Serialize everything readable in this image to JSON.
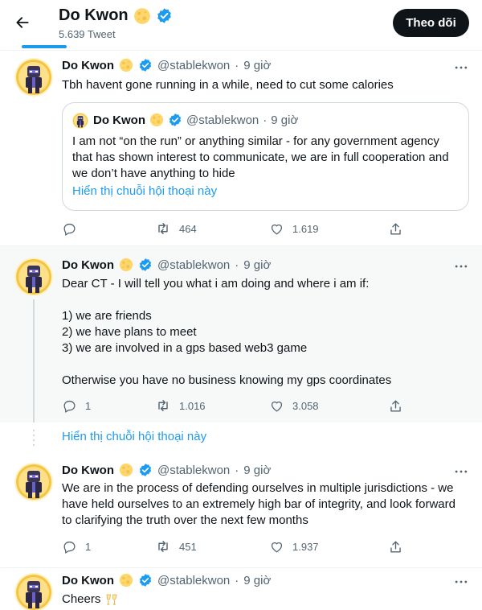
{
  "header": {
    "title": "Do Kwon",
    "tweet_count": "5.639 Tweet",
    "follow_label": "Theo dõi"
  },
  "tweets": [
    {
      "name": "Do Kwon",
      "handle": "@stablekwon",
      "dot": "·",
      "time": "9 giờ",
      "text": "Tbh havent gone running in a while, need to cut some calories",
      "quote": {
        "name": "Do Kwon",
        "handle": "@stablekwon",
        "dot": "·",
        "time": "9 giờ",
        "text": "I am not “on the run” or anything similar - for any government agency that has shown interest to communicate, we are in full cooperation and we don’t have anything to hide",
        "link": "Hiển thị chuỗi hội thoại này"
      },
      "replies": "",
      "retweets": "464",
      "likes": "1.619"
    },
    {
      "name": "Do Kwon",
      "handle": "@stablekwon",
      "dot": "·",
      "time": "9 giờ",
      "text": "Dear CT - I will tell you what i am doing and where i am if:\n\n1) we are friends\n2) we have plans to meet\n3) we are involved in a gps based web3 game\n\nOtherwise you have no business knowing my gps coordinates",
      "replies": "1",
      "retweets": "1.016",
      "likes": "3.058"
    },
    {
      "name": "Do Kwon",
      "handle": "@stablekwon",
      "dot": "·",
      "time": "9 giờ",
      "text": "We are in the process of defending ourselves in multiple jurisdictions - we have held ourselves to an extremely high bar of integrity, and look forward to clarifying the truth over the next few months",
      "replies": "1",
      "retweets": "451",
      "likes": "1.937"
    },
    {
      "name": "Do Kwon",
      "handle": "@stablekwon",
      "dot": "·",
      "time": "9 giờ",
      "text": "Cheers"
    }
  ],
  "show_thread_label": "Hiển thị chuỗi hội thoại này",
  "colors": {
    "accent": "#1d9bf0",
    "text_primary": "#0f1419",
    "text_secondary": "#536471",
    "highlight_bg": "#f7f9f9",
    "follow_bg": "#0f1419",
    "moon": "#ffd66b"
  },
  "icons": [
    "back-arrow-icon",
    "full-moon-icon",
    "verified-badge-icon",
    "more-icon",
    "reply-icon",
    "retweet-icon",
    "like-icon",
    "share-icon",
    "clinking-glasses-icon"
  ]
}
